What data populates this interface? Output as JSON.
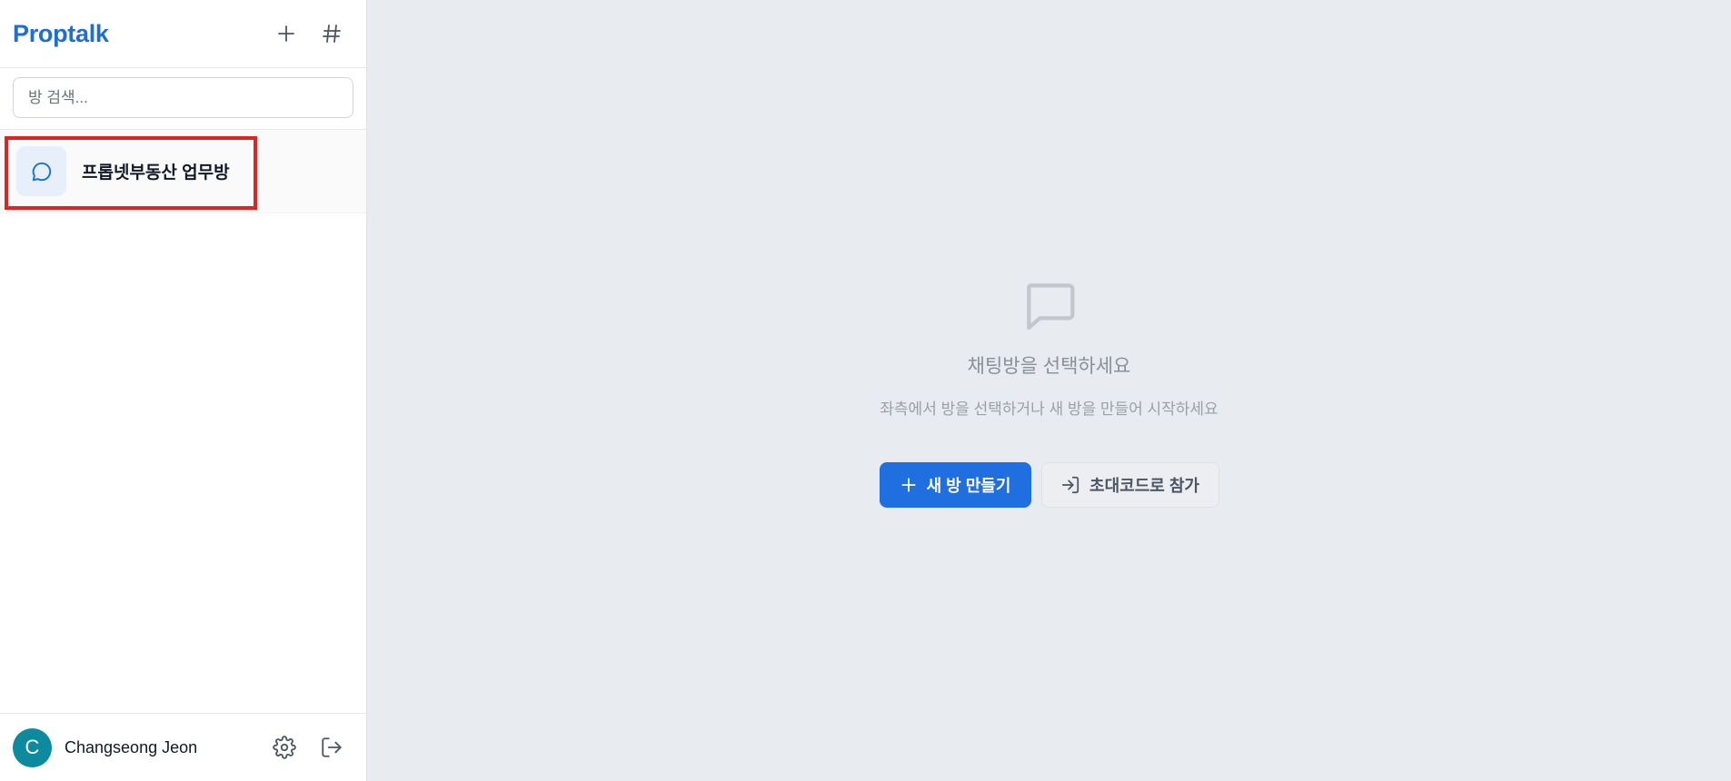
{
  "sidebar": {
    "brand": "Proptalk",
    "header_icons": [
      "plus-icon",
      "hash-icon"
    ],
    "search": {
      "placeholder": "방 검색...",
      "value": ""
    },
    "rooms": [
      {
        "name": "프롭넷부동산 업무방",
        "icon": "chat-bubble-icon"
      }
    ],
    "user": {
      "initial": "C",
      "name": "Changseong Jeon",
      "avatar_color": "#0e8a9e"
    },
    "footer_icons": [
      "gear-icon",
      "logout-icon"
    ]
  },
  "main": {
    "empty_title": "채팅방을 선택하세요",
    "empty_subtitle": "좌측에서 방을 선택하거나 새 방을 만들어 시작하세요",
    "primary_button": "새 방 만들기",
    "secondary_button": "초대코드로 참가"
  },
  "colors": {
    "brand": "#1f6fd1",
    "primary_button": "#1f6fe0",
    "highlight_border": "#dc2626",
    "main_background": "#e8ebf0"
  }
}
